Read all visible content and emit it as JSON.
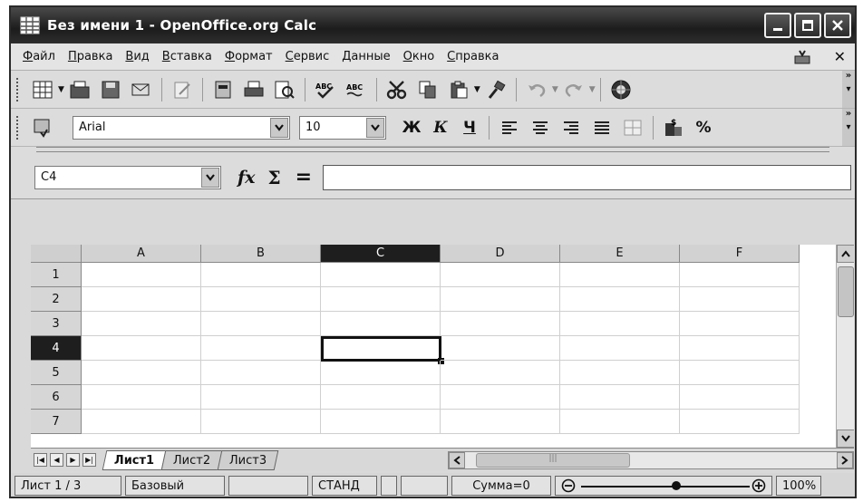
{
  "window": {
    "title": "Без имени 1 - OpenOffice.org Calc"
  },
  "menu": [
    "Файл",
    "Правка",
    "Вид",
    "Вставка",
    "Формат",
    "Сервис",
    "Данные",
    "Окно",
    "Справка"
  ],
  "formatting": {
    "font_name": "Arial",
    "font_size": "10",
    "bold_label": "Ж",
    "italic_label": "К",
    "underline_label": "Ч",
    "percent_label": "%"
  },
  "formula_bar": {
    "name_box": "C4",
    "eq_label": "=",
    "formula": ""
  },
  "grid": {
    "columns": [
      "A",
      "B",
      "C",
      "D",
      "E",
      "F"
    ],
    "rows": [
      "1",
      "2",
      "3",
      "4",
      "5",
      "6",
      "7"
    ],
    "selected_column": "C",
    "selected_row": "4"
  },
  "sheets": {
    "tabs": [
      "Лист1",
      "Лист2",
      "Лист3"
    ],
    "active": "Лист1"
  },
  "status": {
    "sheet": "Лист 1 / 3",
    "style": "Базовый",
    "mode": "СТАНД",
    "sum": "Сумма=0",
    "zoom": "100%",
    "zoom_level": 0.56
  },
  "colors": {
    "title_bar": "#2b2b2b",
    "selection": "#111111"
  }
}
